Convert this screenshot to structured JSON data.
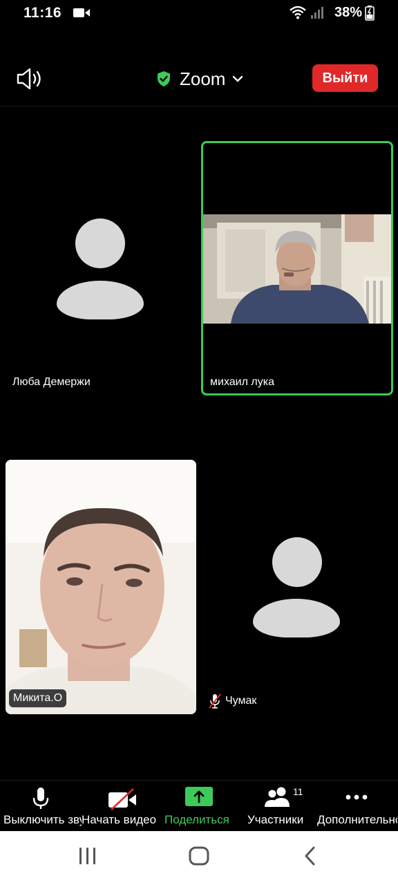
{
  "status_bar": {
    "time": "11:16",
    "battery": "38%",
    "icons": [
      "video-icon",
      "wifi-icon",
      "signal-icon",
      "battery-icon"
    ]
  },
  "top_bar": {
    "speaker_icon": "speaker-icon",
    "meeting_title": "Zoom",
    "shield_icon": "shield-check-icon",
    "leave_label": "Выйти",
    "leave_color": "#e02828"
  },
  "participants": [
    {
      "name": "Люба Демержи",
      "video": false,
      "active_speaker": false
    },
    {
      "name": "михаил лука",
      "video": true,
      "active_speaker": true
    },
    {
      "name": "Микита.О",
      "video": true,
      "active_speaker": false
    },
    {
      "name": "Чумак",
      "video": false,
      "muted": true,
      "active_speaker": false
    }
  ],
  "toolbar": {
    "mute_label": "Выключить звук",
    "video_label": "Начать видео",
    "share_label": "Поделиться",
    "participants_label": "Участники",
    "participants_count": "11",
    "more_label": "Дополнительно"
  },
  "colors": {
    "accent_green": "#3ccb58",
    "leave_red": "#e02828",
    "avatar_gray": "#d8d8d8"
  }
}
